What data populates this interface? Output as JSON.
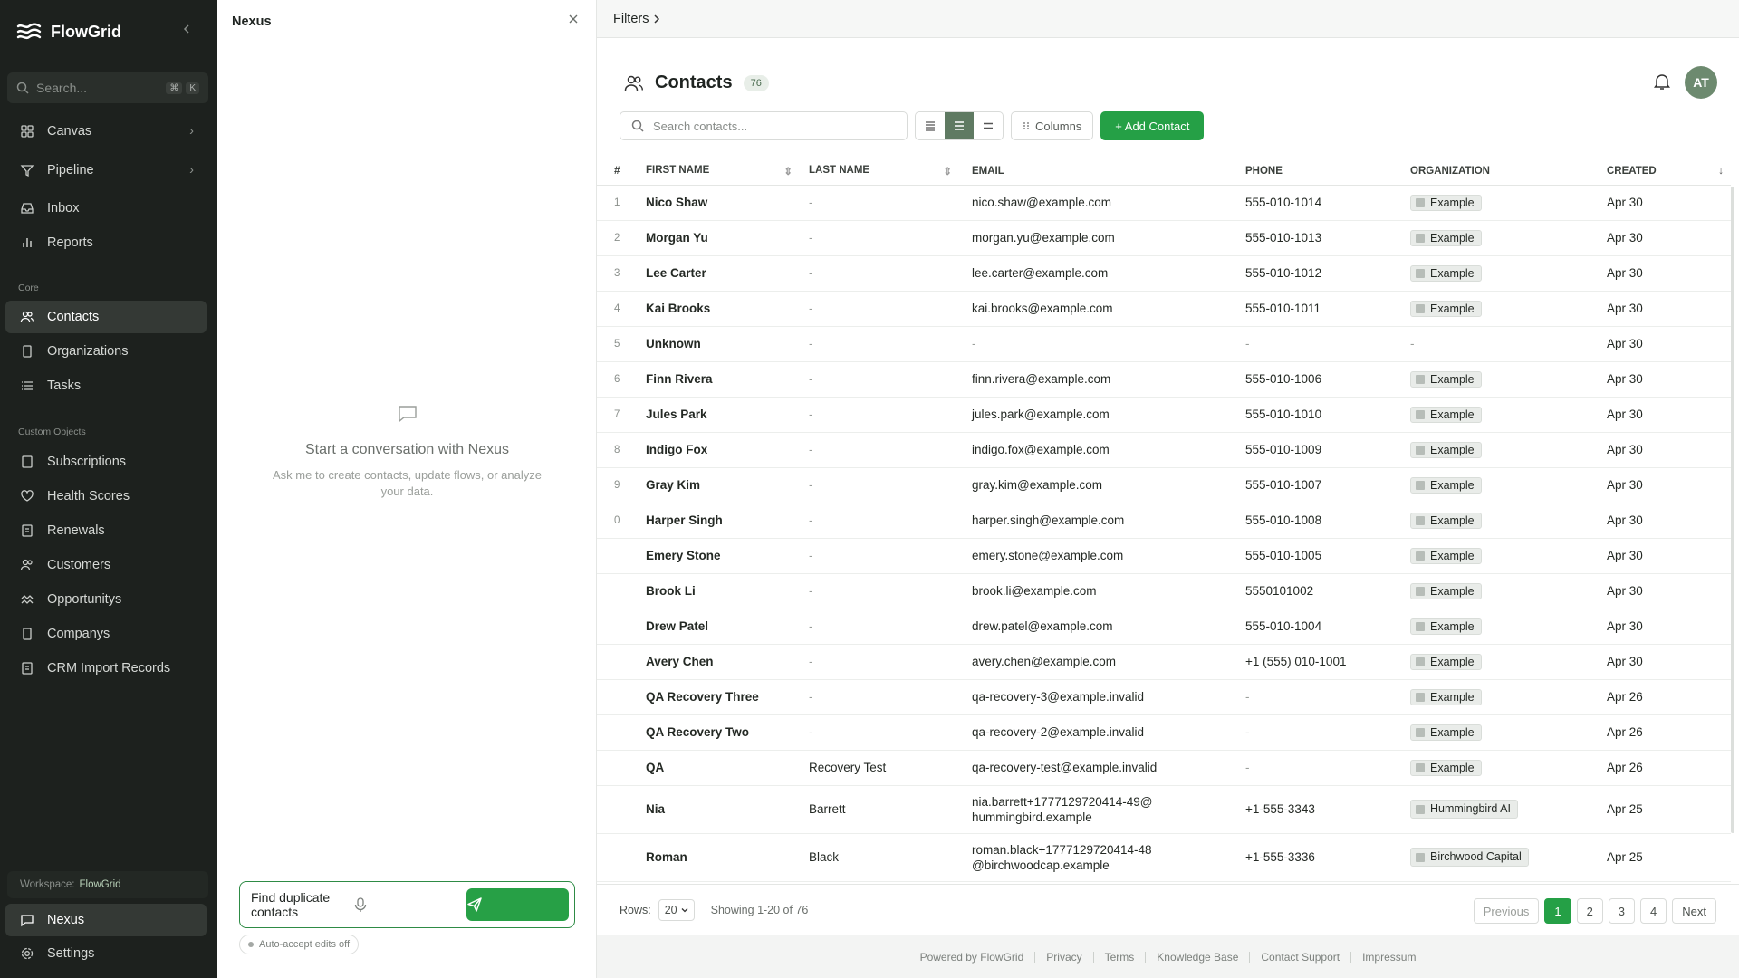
{
  "app": {
    "name": "FlowGrid"
  },
  "sidebar": {
    "search_placeholder": "Search...",
    "shortcut": [
      "⌘",
      "K"
    ],
    "primary": [
      {
        "label": "Canvas",
        "icon": "grid-icon"
      },
      {
        "label": "Pipeline",
        "icon": "filter-icon"
      },
      {
        "label": "Inbox",
        "icon": "inbox-icon"
      },
      {
        "label": "Reports",
        "icon": "bar-chart-icon"
      }
    ],
    "core_label": "Core",
    "core": [
      {
        "label": "Contacts",
        "icon": "users-icon"
      },
      {
        "label": "Organizations",
        "icon": "building-icon"
      },
      {
        "label": "Tasks",
        "icon": "list-icon"
      }
    ],
    "custom_label": "Custom Objects",
    "custom": [
      {
        "label": "Subscriptions",
        "icon": "document-icon"
      },
      {
        "label": "Health Scores",
        "icon": "heart-icon"
      },
      {
        "label": "Renewals",
        "icon": "document-icon"
      },
      {
        "label": "Customers",
        "icon": "users-icon"
      },
      {
        "label": "Opportunitys",
        "icon": "wave-icon"
      },
      {
        "label": "Companys",
        "icon": "building-icon"
      },
      {
        "label": "CRM Import Records",
        "icon": "document-icon"
      }
    ],
    "workspace_label": "Workspace:",
    "workspace_name": "FlowGrid",
    "bottom": [
      {
        "label": "Nexus",
        "icon": "chat-icon"
      },
      {
        "label": "Settings",
        "icon": "gear-icon"
      }
    ]
  },
  "chat": {
    "title": "Nexus",
    "empty_title": "Start a conversation with Nexus",
    "empty_subtitle": "Ask me to create contacts, update flows, or analyze your data.",
    "input_value": "Find duplicate contacts",
    "auto_accept": "Auto-accept edits off"
  },
  "main": {
    "filters_label": "Filters",
    "title": "Contacts",
    "count": "76",
    "avatar": "AT",
    "search_placeholder": "Search contacts...",
    "columns_label": "Columns",
    "add_label": "+ Add Contact",
    "accent": "#25a046"
  },
  "table": {
    "headers": [
      "#",
      "FIRST NAME",
      "LAST NAME",
      "EMAIL",
      "PHONE",
      "ORGANIZATION",
      "CREATED"
    ],
    "rows": [
      {
        "n": "1",
        "first": "Nico Shaw",
        "last": "-",
        "email": "nico.shaw@example.com",
        "phone": "555-010-1014",
        "org": "Example",
        "created": "Apr 30"
      },
      {
        "n": "2",
        "first": "Morgan Yu",
        "last": "-",
        "email": "morgan.yu@example.com",
        "phone": "555-010-1013",
        "org": "Example",
        "created": "Apr 30"
      },
      {
        "n": "3",
        "first": "Lee Carter",
        "last": "-",
        "email": "lee.carter@example.com",
        "phone": "555-010-1012",
        "org": "Example",
        "created": "Apr 30"
      },
      {
        "n": "4",
        "first": "Kai Brooks",
        "last": "-",
        "email": "kai.brooks@example.com",
        "phone": "555-010-1011",
        "org": "Example",
        "created": "Apr 30"
      },
      {
        "n": "5",
        "first": "Unknown",
        "last": "-",
        "email": "-",
        "phone": "-",
        "org": "-",
        "created": "Apr 30"
      },
      {
        "n": "6",
        "first": "Finn Rivera",
        "last": "-",
        "email": "finn.rivera@example.com",
        "phone": "555-010-1006",
        "org": "Example",
        "created": "Apr 30"
      },
      {
        "n": "7",
        "first": "Jules Park",
        "last": "-",
        "email": "jules.park@example.com",
        "phone": "555-010-1010",
        "org": "Example",
        "created": "Apr 30"
      },
      {
        "n": "8",
        "first": "Indigo Fox",
        "last": "-",
        "email": "indigo.fox@example.com",
        "phone": "555-010-1009",
        "org": "Example",
        "created": "Apr 30"
      },
      {
        "n": "9",
        "first": "Gray Kim",
        "last": "-",
        "email": "gray.kim@example.com",
        "phone": "555-010-1007",
        "org": "Example",
        "created": "Apr 30"
      },
      {
        "n": "0",
        "first": "Harper Singh",
        "last": "-",
        "email": "harper.singh@example.com",
        "phone": "555-010-1008",
        "org": "Example",
        "created": "Apr 30"
      },
      {
        "n": "",
        "first": "Emery Stone",
        "last": "-",
        "email": "emery.stone@example.com",
        "phone": "555-010-1005",
        "org": "Example",
        "created": "Apr 30"
      },
      {
        "n": "",
        "first": "Brook Li",
        "last": "-",
        "email": "brook.li@example.com",
        "phone": "5550101002",
        "org": "Example",
        "created": "Apr 30"
      },
      {
        "n": "",
        "first": "Drew Patel",
        "last": "-",
        "email": "drew.patel@example.com",
        "phone": "555-010-1004",
        "org": "Example",
        "created": "Apr 30"
      },
      {
        "n": "",
        "first": "Avery Chen",
        "last": "-",
        "email": "avery.chen@example.com",
        "phone": "+1 (555) 010-1001",
        "org": "Example",
        "created": "Apr 30"
      },
      {
        "n": "",
        "first": "QA Recovery Three",
        "last": "-",
        "email": "qa-recovery-3@example.invalid",
        "phone": "-",
        "org": "Example",
        "created": "Apr 26"
      },
      {
        "n": "",
        "first": "QA Recovery Two",
        "last": "-",
        "email": "qa-recovery-2@example.invalid",
        "phone": "-",
        "org": "Example",
        "created": "Apr 26"
      },
      {
        "n": "",
        "first": "QA",
        "last": "Recovery Test",
        "email": "qa-recovery-test@example.invalid",
        "phone": "-",
        "org": "Example",
        "created": "Apr 26"
      },
      {
        "n": "",
        "first": "Nia",
        "last": "Barrett",
        "email": "nia.barrett+1777129720414-49@hummingbird.example",
        "phone": "+1-555-3343",
        "org": "Hummingbird AI",
        "created": "Apr 25"
      },
      {
        "n": "",
        "first": "Roman",
        "last": "Black",
        "email": "roman.black+1777129720414-48@birchwoodcap.example",
        "phone": "+1-555-3336",
        "org": "Birchwood Capital",
        "created": "Apr 25"
      }
    ]
  },
  "pagination": {
    "rows_label": "Rows:",
    "rows_value": "20",
    "showing": "Showing 1-20 of 76",
    "previous": "Previous",
    "pages": [
      "1",
      "2",
      "3",
      "4"
    ],
    "next": "Next"
  },
  "footer": {
    "links": [
      "Powered by FlowGrid",
      "Privacy",
      "Terms",
      "Knowledge Base",
      "Contact Support",
      "Impressum"
    ]
  }
}
